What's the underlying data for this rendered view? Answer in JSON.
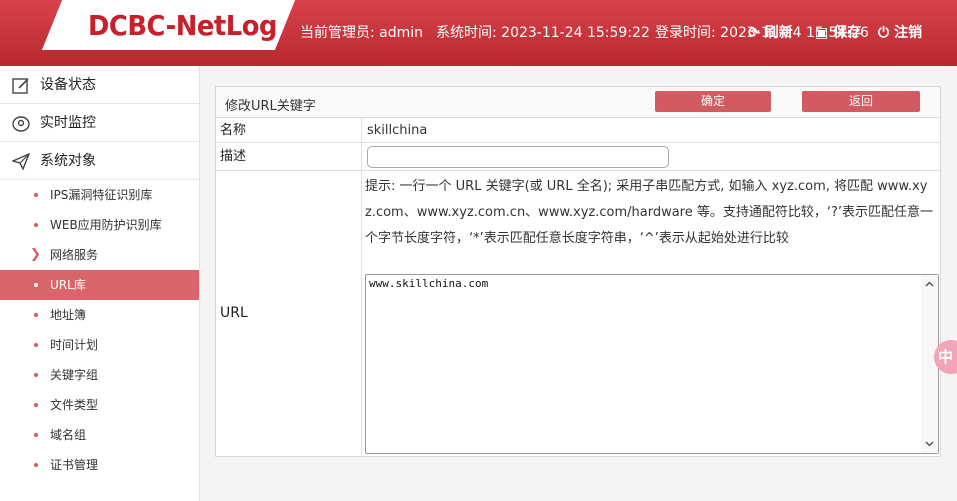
{
  "header": {
    "logo": "DCBC-NetLog",
    "admin": "当前管理员: admin",
    "system_time": "系统时间: 2023-11-24 15:59:22",
    "login_time": "登录时间: 2023-11-24 15:54:26",
    "refresh": "刷新",
    "save": "保存",
    "logout": "注销"
  },
  "sidebar": {
    "main_items": [
      {
        "label": "设备状态",
        "icon": "edit-icon"
      },
      {
        "label": "实时监控",
        "icon": "location-icon"
      },
      {
        "label": "系统对象",
        "icon": "send-icon"
      }
    ],
    "sub_items": [
      {
        "label": "IPS漏洞特征识别库"
      },
      {
        "label": "WEB应用防护识别库"
      },
      {
        "label": "网络服务"
      },
      {
        "label": "URL库"
      },
      {
        "label": "地址簿"
      },
      {
        "label": "时间计划"
      },
      {
        "label": "关键字组"
      },
      {
        "label": "文件类型"
      },
      {
        "label": "域名组"
      },
      {
        "label": "证书管理"
      }
    ]
  },
  "form": {
    "title": "修改URL关键字",
    "confirm": "确定",
    "back": "返回",
    "name_label": "名称",
    "name_value": "skillchina",
    "desc_label": "描述",
    "desc_value": "",
    "url_label": "URL",
    "hint": "提示: 一行一个 URL 关键字(或 URL 全名); 采用子串匹配方式, 如输入 xyz.com, 将匹配 www.xyz.com、www.xyz.com.cn、www.xyz.com/hardware 等。支持通配符比较，‘?’表示匹配任意一个字节长度字符，‘*’表示匹配任意长度字符串，‘^’表示从起始处进行比较",
    "url_value": "www.skillchina.com"
  },
  "float_badge": "中"
}
